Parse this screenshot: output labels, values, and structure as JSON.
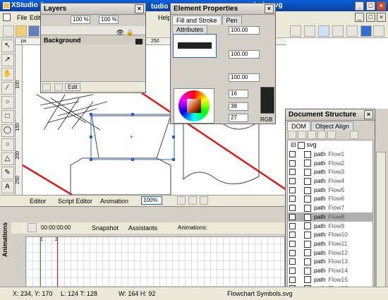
{
  "app": {
    "title": "XStudio 6.",
    "file_title": "bols.svg",
    "app_title_2": "tudio 6."
  },
  "menu": {
    "file": "File",
    "edit": "Edit",
    "help": "Help"
  },
  "layers": {
    "title": "Layers",
    "zoom1": "100 %",
    "zoom2": "100 %",
    "background_layer": "Background",
    "edit_label": "Edit"
  },
  "props": {
    "title": "Element Properties",
    "tabs": [
      "Fill and Stroke",
      "Pen",
      "Attributes"
    ],
    "stroke_value": "100.00",
    "fill_value": "100.00",
    "opacity_value": "100.00",
    "r_value": "16",
    "g_value": "38",
    "b_value": "27",
    "rgb_label": "RGB"
  },
  "doc": {
    "title": "Document Structure",
    "tabs": [
      "DOM",
      "Object Align"
    ],
    "root": "svg",
    "path_label": "path",
    "flows": [
      "Flow1",
      "Flow2",
      "Flow3",
      "Flow4",
      "Flow5",
      "Flow6",
      "Flow7",
      "Flow8",
      "Flow9",
      "Flow10",
      "Flow11",
      "Flow12",
      "Flow13",
      "Flow14",
      "Flow15",
      "Flow16"
    ],
    "selected_index": 7
  },
  "ruler": {
    "h_ticks": [
      "250",
      "300",
      "350"
    ],
    "v_ticks": [
      "100",
      "150",
      "200",
      "250"
    ],
    "px_label": "px"
  },
  "bottom_tabs": {
    "editor": "Editor",
    "script_editor": "Script Editor",
    "animation": "Animation",
    "zoom": "100%"
  },
  "anim": {
    "side_label": "Animations",
    "time": "00:00:00:00",
    "snapshot": "Snapshot",
    "assistants": "Assistants",
    "animations_label": "Animations:",
    "timeline_ticks": [
      "1",
      "2"
    ]
  },
  "status": {
    "xy": "X: 234, Y: 170",
    "lt": "L: 124 T: 128",
    "wh": "W: 164 H: 92",
    "filename": "Flowchart Symbols.svg"
  },
  "colors": {
    "accent": "#0a4fc0",
    "red_line": "#e01818",
    "canvas": "#ffffff"
  }
}
